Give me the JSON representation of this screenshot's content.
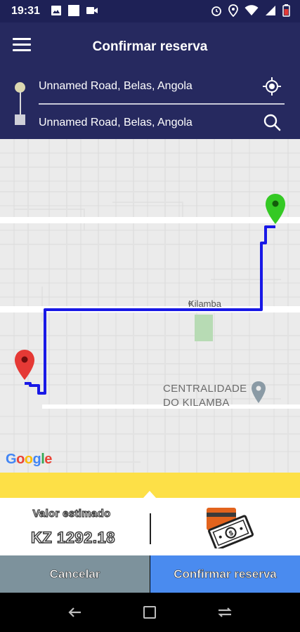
{
  "status_bar": {
    "time": "19:31",
    "left_icons": [
      "image-icon",
      "square-icon",
      "video-icon"
    ],
    "right_icons": [
      "alarm-icon",
      "location-icon",
      "wifi-icon",
      "signal-icon",
      "battery-icon"
    ]
  },
  "header": {
    "title": "Confirmar reserva",
    "menu_icon": "hamburger-menu-icon",
    "origin_address": "Unnamed Road, Belas, Angola",
    "destination_address": "Unnamed Road, Belas, Angola",
    "origin_action_icon": "my-location-icon",
    "destination_action_icon": "search-icon",
    "background_color": "#26295f"
  },
  "map": {
    "place_label": "Kilamba",
    "poi_label_line1": "CENTRALIDADE",
    "poi_label_line2": "DO KILAMBA",
    "provider": "Google",
    "route_color": "#1818e6",
    "origin_marker_color": "#e53935",
    "destination_marker_color": "#34c924"
  },
  "fare_panel": {
    "label": "Valor estimado",
    "value": "KZ 1292.18",
    "payment_icon": "cash-payment-icon",
    "accent_color": "#fde047"
  },
  "actions": {
    "cancel_label": "Cancelar",
    "confirm_label": "Confirmar reserva"
  },
  "nav_bar": {
    "icons": [
      "back-icon",
      "home-icon",
      "recent-apps-icon"
    ]
  }
}
